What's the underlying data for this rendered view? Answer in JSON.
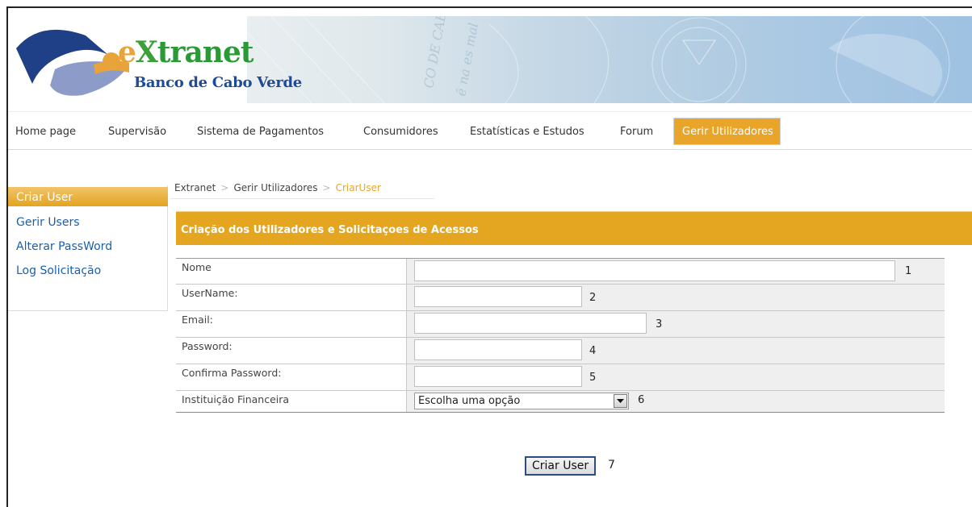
{
  "logo": {
    "title_e": "e",
    "title_x": "X",
    "title_rest": "tranet",
    "bank_name": "Banco de Cabo Verde"
  },
  "nav": {
    "items": [
      {
        "label": "Home page"
      },
      {
        "label": "Supervisão"
      },
      {
        "label": "Sistema de Pagamentos"
      },
      {
        "label": "Consumidores"
      },
      {
        "label": "Estatísticas e Estudos"
      },
      {
        "label": "Forum"
      },
      {
        "label": "Gerir Utilizadores"
      }
    ],
    "active_index": 6
  },
  "sidebar": {
    "items": [
      {
        "label": "Criar User"
      },
      {
        "label": "Gerir Users"
      },
      {
        "label": "Alterar PassWord"
      },
      {
        "label": "Log Solicitação"
      }
    ]
  },
  "breadcrumb": {
    "items": [
      "Extranet",
      "Gerir Utilizadores",
      "CriarUser"
    ],
    "separator": ">"
  },
  "section": {
    "title": "Criação dos Utilizadores e Solicitaçoes de Acessos"
  },
  "form": {
    "fields": [
      {
        "label": "Nome",
        "value": "",
        "number": "1"
      },
      {
        "label": "UserName:",
        "value": "",
        "number": "2"
      },
      {
        "label": "Email:",
        "value": "",
        "number": "3"
      },
      {
        "label": "Password:",
        "value": "",
        "number": "4"
      },
      {
        "label": "Confirma Password:",
        "value": "",
        "number": "5"
      },
      {
        "label": "Instituição Financeira",
        "selected": "Escolha uma opção",
        "number": "6"
      }
    ],
    "submit_label": "Criar User",
    "submit_number": "7"
  },
  "colors": {
    "accent": "#e4a620",
    "link": "#1a5fae",
    "brand_blue": "#1f4a96"
  }
}
